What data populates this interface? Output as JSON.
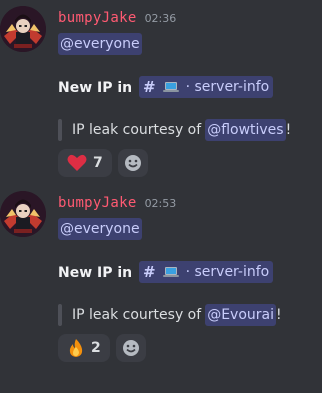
{
  "messages": [
    {
      "username": "bumpyJake",
      "time": "02:36",
      "mention": "@everyone",
      "body_prefix": "New IP in",
      "channel_hash": "#",
      "channel_name": "· server-info",
      "quote_text": "IP leak courtesy of",
      "quote_mention": "@flowtives",
      "quote_suffix": "!",
      "reaction_emoji": "heart-icon",
      "reaction_count": "7"
    },
    {
      "username": "bumpyJake",
      "time": "02:53",
      "mention": "@everyone",
      "body_prefix": "New IP in",
      "channel_hash": "#",
      "channel_name": "· server-info",
      "quote_text": "IP leak courtesy of",
      "quote_mention": "@Evourai",
      "quote_suffix": "!",
      "reaction_emoji": "fire-icon",
      "reaction_count": "2"
    }
  ],
  "colors": {
    "background": "#313338",
    "username": "#ff5a72",
    "mention_bg": "#4d559c",
    "accent": "#5865f2"
  }
}
